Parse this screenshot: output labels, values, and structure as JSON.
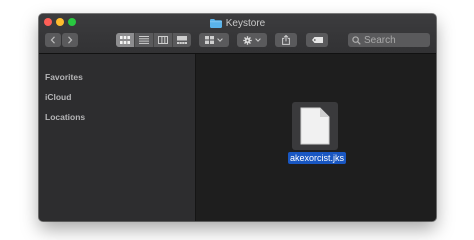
{
  "window": {
    "title": "Keystore",
    "title_icon": "folder-icon"
  },
  "toolbar": {
    "back_icon": "chevron-left-icon",
    "forward_icon": "chevron-right-icon",
    "view_modes": [
      {
        "name": "icon-view",
        "icon": "grid-icon",
        "active": true
      },
      {
        "name": "list-view",
        "icon": "list-icon",
        "active": false
      },
      {
        "name": "column-view",
        "icon": "columns-icon",
        "active": false
      },
      {
        "name": "gallery-view",
        "icon": "gallery-icon",
        "active": false
      }
    ],
    "group_icon": "group-grid-icon",
    "action_icon": "gear-icon",
    "share_icon": "share-icon",
    "tag_icon": "tag-icon",
    "search_placeholder": "Search"
  },
  "sidebar": {
    "items": [
      {
        "label": "Favorites"
      },
      {
        "label": "iCloud"
      },
      {
        "label": "Locations"
      }
    ]
  },
  "content": {
    "files": [
      {
        "name": "akexorcist.jks",
        "icon": "document-icon",
        "selected": true
      }
    ]
  },
  "colors": {
    "close": "#fe5f57",
    "minimize": "#febc2e",
    "zoom": "#29c840",
    "folder": "#5ab3ea",
    "selection": "#1957c2"
  }
}
